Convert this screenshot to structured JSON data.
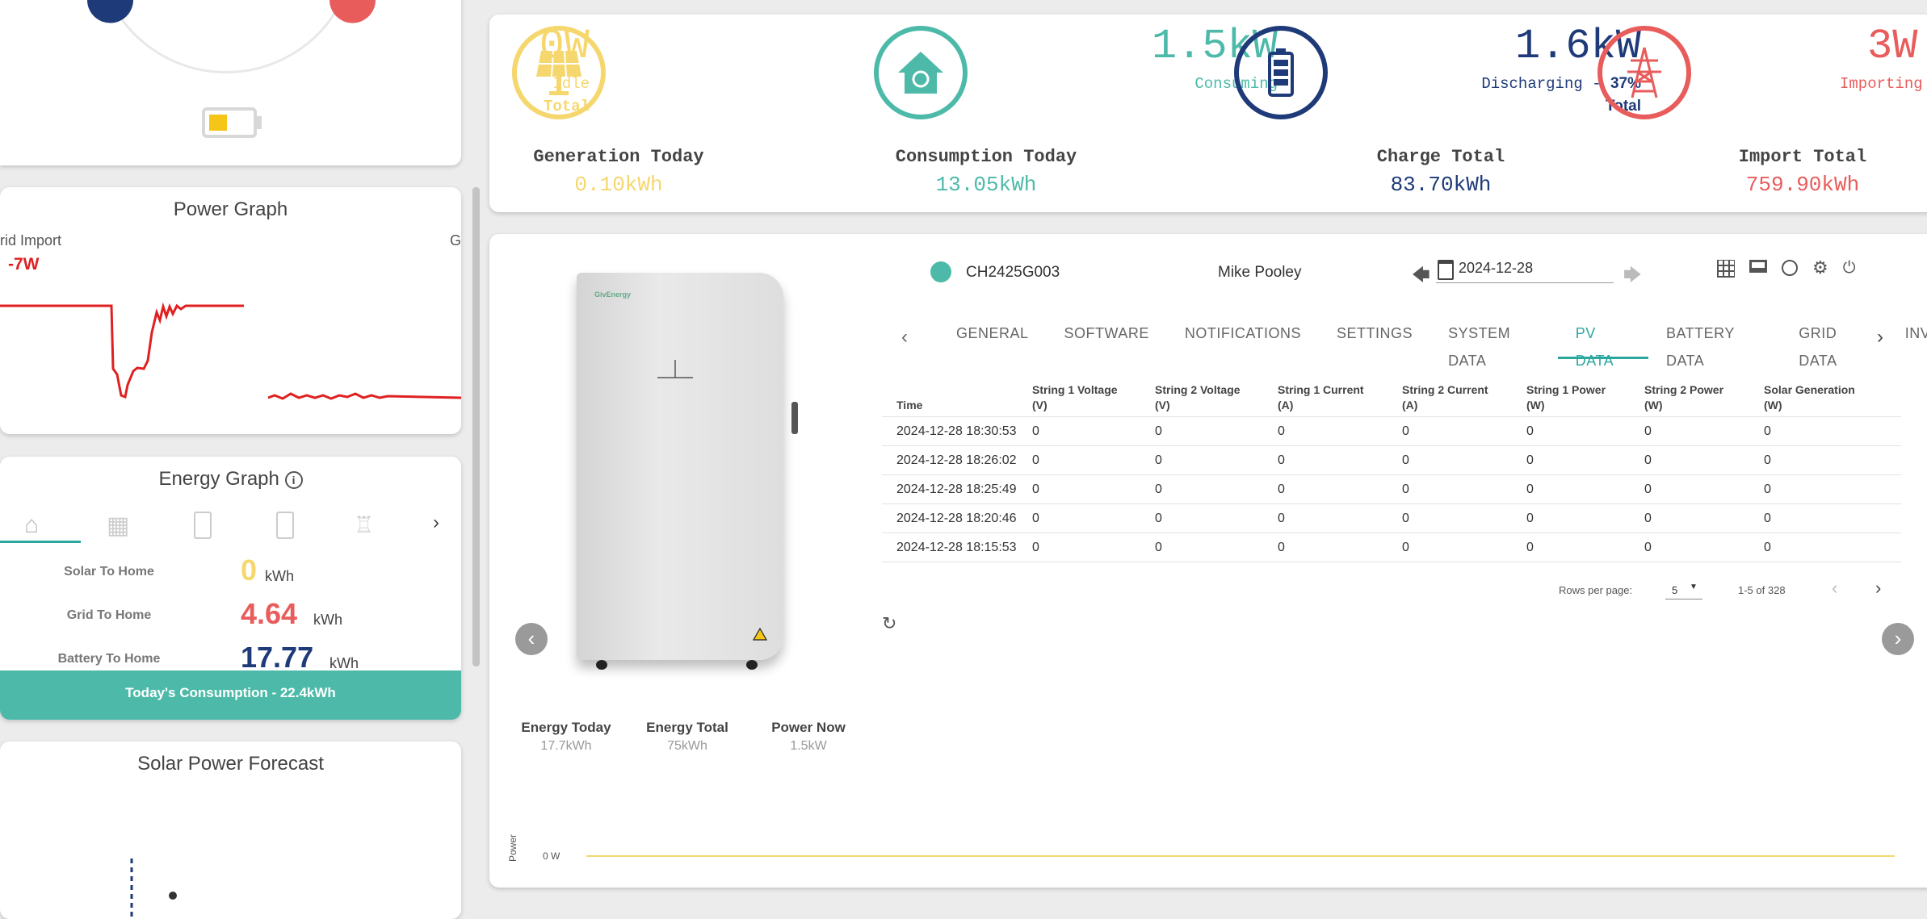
{
  "power_graph": {
    "title": "Power Graph",
    "grid_import_label": "rid Import",
    "grid_import_value": "-7W",
    "cut_label": "G"
  },
  "energy_graph": {
    "title": "Energy Graph",
    "rows": [
      {
        "label": "Solar To Home",
        "value": "0",
        "unit": "kWh",
        "color": "#f5d76e"
      },
      {
        "label": "Grid To Home",
        "value": "4.64",
        "unit": "kWh",
        "color": "#e85c5c"
      },
      {
        "label": "Battery To Home",
        "value": "17.77",
        "unit": "kWh",
        "color": "#1e3a78"
      }
    ],
    "footer": "Today's Consumption - 22.4kWh"
  },
  "forecast": {
    "title": "Solar Power Forecast"
  },
  "summary": {
    "solar": {
      "value": "0W",
      "line1": "Idle",
      "line2": "Total",
      "color": "#f5d76e"
    },
    "home": {
      "value": "1.5kW",
      "line1": "Consuming",
      "color": "#4dbaa9"
    },
    "battery": {
      "value": "1.6kW",
      "line1": "Discharging - ",
      "pct": "37%",
      "line2": "Total",
      "color": "#1e3a78"
    },
    "grid": {
      "value": "3W",
      "line1": "Importing",
      "color": "#e85c5c"
    },
    "totals": [
      {
        "label": "Generation Today",
        "value": "0.10kWh",
        "color": "#f5d76e"
      },
      {
        "label": "Consumption Today",
        "value": "13.05kWh",
        "color": "#4dbaa9"
      },
      {
        "label": "Charge Total",
        "value": "83.70kWh",
        "color": "#1e3a78"
      },
      {
        "label": "Import Total",
        "value": "759.90kWh",
        "color": "#e85c5c"
      }
    ]
  },
  "device": {
    "serial": "CH2425G003",
    "owner": "Mike Pooley",
    "date": "2024-12-28",
    "brand": "GivEnergy",
    "stats": [
      {
        "label": "Energy Today",
        "value": "17.7kWh"
      },
      {
        "label": "Energy Total",
        "value": "75kWh"
      },
      {
        "label": "Power Now",
        "value": "1.5kW"
      }
    ]
  },
  "tabs": [
    "GENERAL",
    "SOFTWARE",
    "NOTIFICATIONS",
    "SETTINGS",
    "SYSTEM DATA",
    "PV DATA",
    "BATTERY DATA",
    "GRID DATA",
    "INVER"
  ],
  "active_tab": "PV DATA",
  "table": {
    "headers": [
      [
        "Time",
        ""
      ],
      [
        "String 1 Voltage",
        "(V)"
      ],
      [
        "String 2 Voltage",
        "(V)"
      ],
      [
        "String 1 Current",
        "(A)"
      ],
      [
        "String 2 Current",
        "(A)"
      ],
      [
        "String 1 Power",
        "(W)"
      ],
      [
        "String 2 Power",
        "(W)"
      ],
      [
        "Solar Generation",
        "(W)"
      ]
    ],
    "rows": [
      [
        "2024-12-28 18:30:53",
        "0",
        "0",
        "0",
        "0",
        "0",
        "0",
        "0"
      ],
      [
        "2024-12-28 18:26:02",
        "0",
        "0",
        "0",
        "0",
        "0",
        "0",
        "0"
      ],
      [
        "2024-12-28 18:25:49",
        "0",
        "0",
        "0",
        "0",
        "0",
        "0",
        "0"
      ],
      [
        "2024-12-28 18:20:46",
        "0",
        "0",
        "0",
        "0",
        "0",
        "0",
        "0"
      ],
      [
        "2024-12-28 18:15:53",
        "0",
        "0",
        "0",
        "0",
        "0",
        "0",
        "0"
      ]
    ]
  },
  "pagination": {
    "rows_label": "Rows per page:",
    "rows_value": "5",
    "range": "1-5 of 328"
  },
  "bottom_chart": {
    "ylabel": "Power",
    "tick": "0 W"
  }
}
